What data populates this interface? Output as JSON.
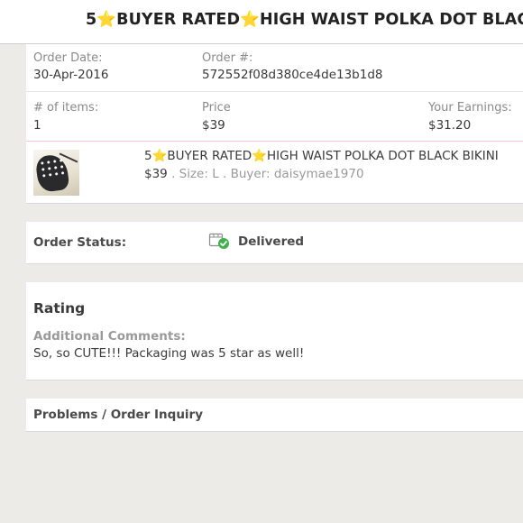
{
  "header": {
    "title_part1": "5",
    "star": "⭐",
    "title_part2": "BUYER RATED",
    "title_part3": "HIGH WAIST POLKA DOT BLACK BIKINI"
  },
  "order": {
    "date_label": "Order Date:",
    "date_value": "30-Apr-2016",
    "number_label": "Order #:",
    "number_value": "572552f08d380ce4de13b1d8",
    "items_label": "# of items:",
    "items_value": "1",
    "price_label": "Price",
    "price_value": "$39",
    "earnings_label": "Your Earnings:",
    "earnings_value": "$31.20"
  },
  "item": {
    "title_part1": "5",
    "star": "⭐",
    "title_part2": "BUYER RATED",
    "title_part3": "HIGH WAIST POLKA DOT BLACK BIKINI",
    "price": "$39",
    "size_text": " . Size: L . Buyer: daisymae1970"
  },
  "status": {
    "label": "Order Status:",
    "value": "Delivered",
    "icon": "package-delivered-icon",
    "check_color": "#3fb04a"
  },
  "rating": {
    "title": "Rating",
    "comments_label": "Additional Comments:",
    "comments_text": "So, so CUTE!!! Packaging was 5 star as well!"
  },
  "problems": {
    "label": "Problems / Order Inquiry"
  },
  "colors": {
    "background": "#ecebe8",
    "panel": "#ffffff",
    "accent_divider": "#f0c9cf",
    "star": "#f2c12e"
  }
}
